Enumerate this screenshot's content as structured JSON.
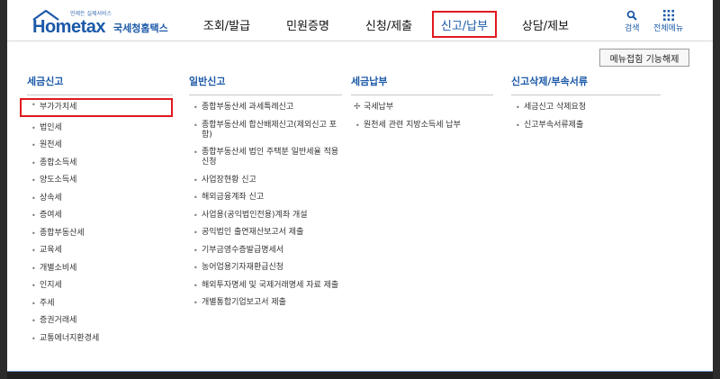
{
  "logo": {
    "tagline": "언제든 실제서비스",
    "brand": "Hometax",
    "korean_name": "국세청홈택스"
  },
  "nav": [
    {
      "label": "조회/발급",
      "active": false
    },
    {
      "label": "민원증명",
      "active": false
    },
    {
      "label": "신청/제출",
      "active": false
    },
    {
      "label": "신고/납부",
      "active": true
    },
    {
      "label": "상담/제보",
      "active": false
    }
  ],
  "utility": {
    "search_label": "검색",
    "menu_label": "전체메뉴"
  },
  "fold_button_label": "메뉴접힘 기능해제",
  "columns": [
    {
      "title": "세금신고",
      "items": [
        "부가가치세",
        "법인세",
        "원천세",
        "종합소득세",
        "양도소득세",
        "상속세",
        "증여세",
        "종합부동산세",
        "교육세",
        "개별소비세",
        "인지세",
        "주세",
        "증권거래세",
        "교통에너지환경세"
      ]
    },
    {
      "title": "일반신고",
      "items": [
        "종합부동산세 과세특례신고",
        "종합부동산세 합산배제신고(제외신고 포함)",
        "종합부동산세 법인 주택분 일반세율 적용 신청",
        "사업장현황 신고",
        "해외금융계좌 신고",
        "사업용(공익법인전용)계좌 개설",
        "공익법인 출연재산보고서 제출",
        "기부금영수증발급명세서",
        "농어업용기자재환급신청",
        "해외투자명세 및 국제거래명세 자료 제출",
        "개별통합기업보고서 제출"
      ]
    },
    {
      "title": "세금납부",
      "items": [
        "국세납부",
        "원천세 관련 지방소득세 납부"
      ]
    },
    {
      "title": "신고삭제/부속서류",
      "items": [
        "세금신고 삭제요청",
        "신고부속서류제출"
      ]
    }
  ]
}
